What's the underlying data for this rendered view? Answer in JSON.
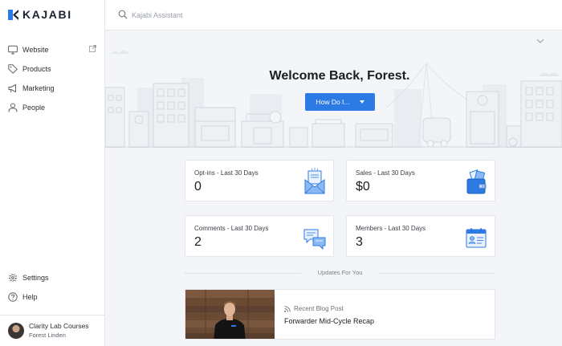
{
  "brand": {
    "name": "KAJABI",
    "accent": "#2c7be5"
  },
  "sidebar": {
    "items": [
      {
        "label": "Website",
        "icon": "monitor-icon"
      },
      {
        "label": "Products",
        "icon": "tag-icon"
      },
      {
        "label": "Marketing",
        "icon": "megaphone-icon"
      },
      {
        "label": "People",
        "icon": "person-icon"
      }
    ],
    "bottom_items": [
      {
        "label": "Settings",
        "icon": "gear-icon"
      },
      {
        "label": "Help",
        "icon": "help-icon"
      }
    ],
    "user": {
      "course": "Clarity Lab Courses",
      "name": "Forest Linden"
    }
  },
  "search": {
    "placeholder": "Kajabi Assistant"
  },
  "hero": {
    "title": "Welcome Back, Forest.",
    "button_label": "How Do I..."
  },
  "stats": [
    {
      "label": "Opt-ins - Last 30 Days",
      "value": "0",
      "icon": "envelope-icon"
    },
    {
      "label": "Sales - Last 30 Days",
      "value": "$0",
      "icon": "wallet-icon"
    },
    {
      "label": "Comments - Last 30 Days",
      "value": "2",
      "icon": "chat-bubbles-icon"
    },
    {
      "label": "Members - Last 30 Days",
      "value": "3",
      "icon": "id-card-icon"
    }
  ],
  "updates": {
    "heading": "Updates For You",
    "post": {
      "kind": "Recent Blog Post",
      "title": "Forwarder Mid-Cycle Recap"
    }
  }
}
